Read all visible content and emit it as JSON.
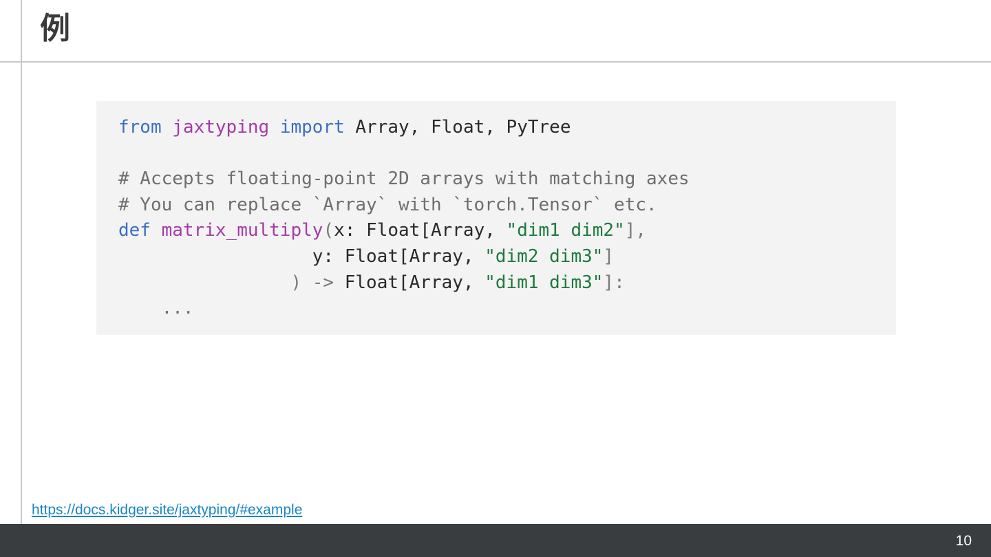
{
  "slide": {
    "title": "例",
    "source_link": "https://docs.kidger.site/jaxtyping/#example",
    "page_number": "10"
  },
  "code": {
    "line1": {
      "kw_from": "from",
      "module": "jaxtyping",
      "kw_import": "import",
      "names": "Array, Float, PyTree"
    },
    "line2": "",
    "line3": "# Accepts floating-point 2D arrays with matching axes",
    "line4": "# You can replace `Array` with `torch.Tensor` etc.",
    "line5": {
      "kw_def": "def",
      "fn_name": "matrix_multiply",
      "open": "(",
      "params": "x: Float[Array, ",
      "str": "\"dim1 dim2\"",
      "close": "],"
    },
    "line6": {
      "indent": "                  ",
      "params": "y: Float[Array, ",
      "str": "\"dim2 dim3\"",
      "close": "]"
    },
    "line7": {
      "indent": "                ",
      "arrow": ") -> ",
      "ret": "Float[Array, ",
      "str": "\"dim1 dim3\"",
      "close": "]:"
    },
    "line8": "    ..."
  },
  "colors": {
    "keyword": "#3b6fc6",
    "module_and_function": "#a43ba6",
    "string": "#1e7a3c",
    "comment": "#6e6e6e",
    "link": "#1a85c8",
    "footer": "#3a3d40"
  }
}
